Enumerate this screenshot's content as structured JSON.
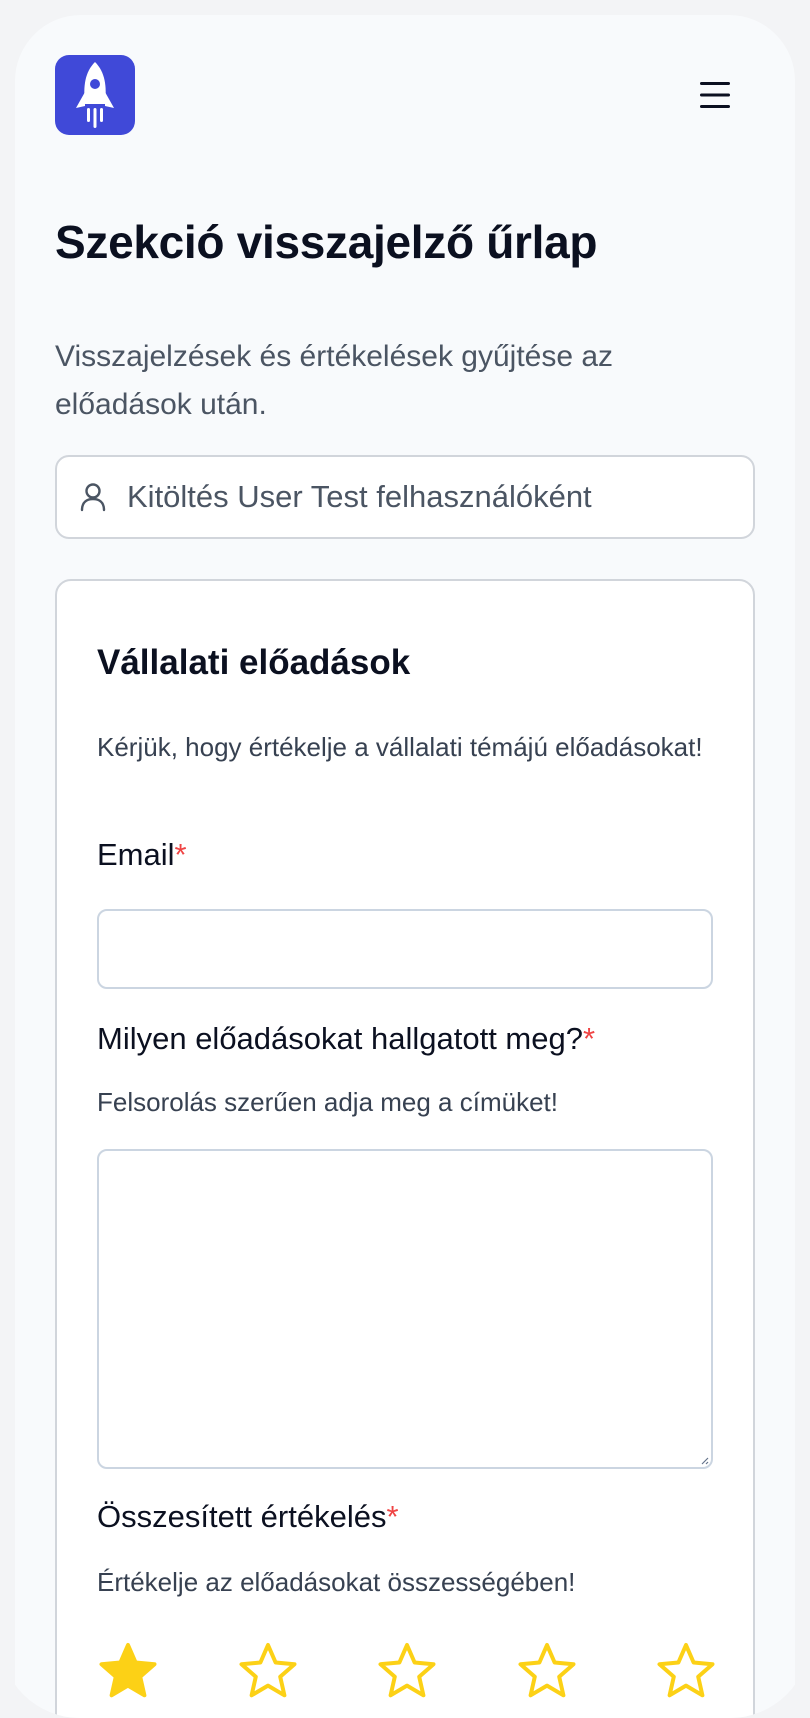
{
  "header": {
    "logo_icon": "rocket-icon",
    "menu_icon": "hamburger-menu-icon"
  },
  "page": {
    "title": "Szekció visszajelző űrlap",
    "subtitle": "Visszajelzések és értékelések gyűjtése az előadások után."
  },
  "user_banner": {
    "icon": "user-icon",
    "text": "Kitöltés User Test felhasználóként"
  },
  "section": {
    "title": "Vállalati előadások",
    "description": "Kérjük, hogy értékelje a vállalati témájú előadásokat!"
  },
  "fields": {
    "email": {
      "label": "Email",
      "required_mark": "*",
      "value": ""
    },
    "talks": {
      "label": "Milyen előadásokat hallgatott meg?",
      "required_mark": "*",
      "hint": "Felsorolás szerűen adja meg a címüket!",
      "value": ""
    },
    "rating": {
      "label": "Összesített értékelés",
      "required_mark": "*",
      "hint": "Értékelje az előadásokat összességében!",
      "max": 5,
      "value": 1
    }
  },
  "colors": {
    "brand": "#4049d8",
    "star": "#fcd116",
    "required": "#ef4444"
  }
}
